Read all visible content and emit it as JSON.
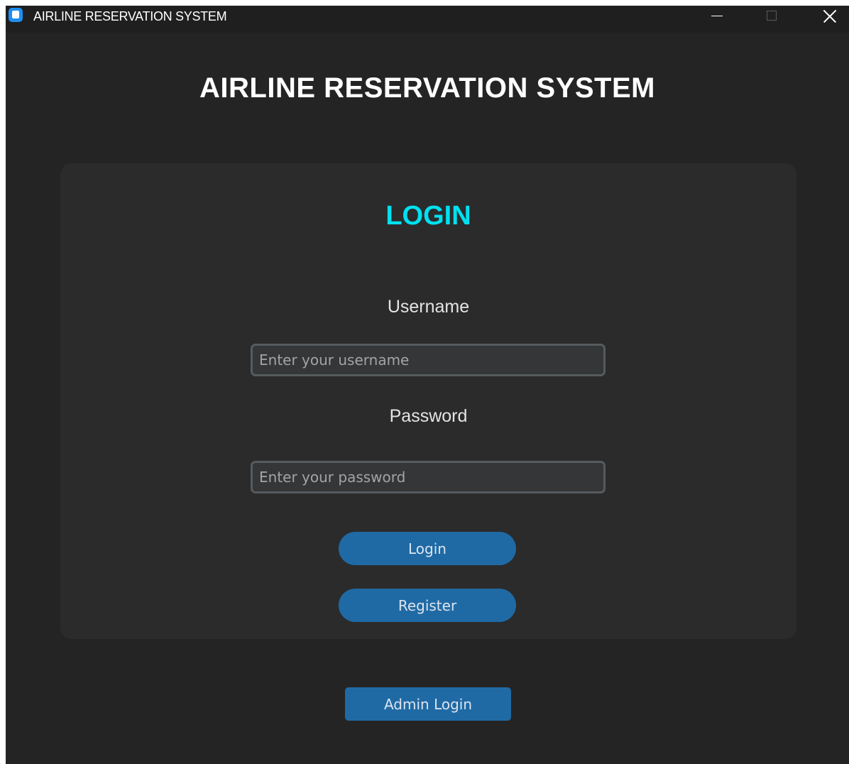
{
  "window": {
    "title": "AIRLINE RESERVATION SYSTEM",
    "icon": "app-icon",
    "controls": {
      "minimize": "minimize-icon",
      "maximize": "maximize-icon",
      "close": "close-icon"
    }
  },
  "header": {
    "title": "AIRLINE RESERVATION SYSTEM"
  },
  "login_card": {
    "heading": "LOGIN",
    "username": {
      "label": "Username",
      "value": "",
      "placeholder": "Enter your username"
    },
    "password": {
      "label": "Password",
      "value": "",
      "placeholder": "Enter your password"
    },
    "login_button": "Login",
    "register_button": "Register"
  },
  "admin_button": "Admin Login",
  "colors": {
    "background": "#242424",
    "card": "#2b2b2b",
    "heading_accent": "#00e0f0",
    "button": "#1f6aa5",
    "input_bg": "#343638",
    "input_border": "#565b5e"
  }
}
